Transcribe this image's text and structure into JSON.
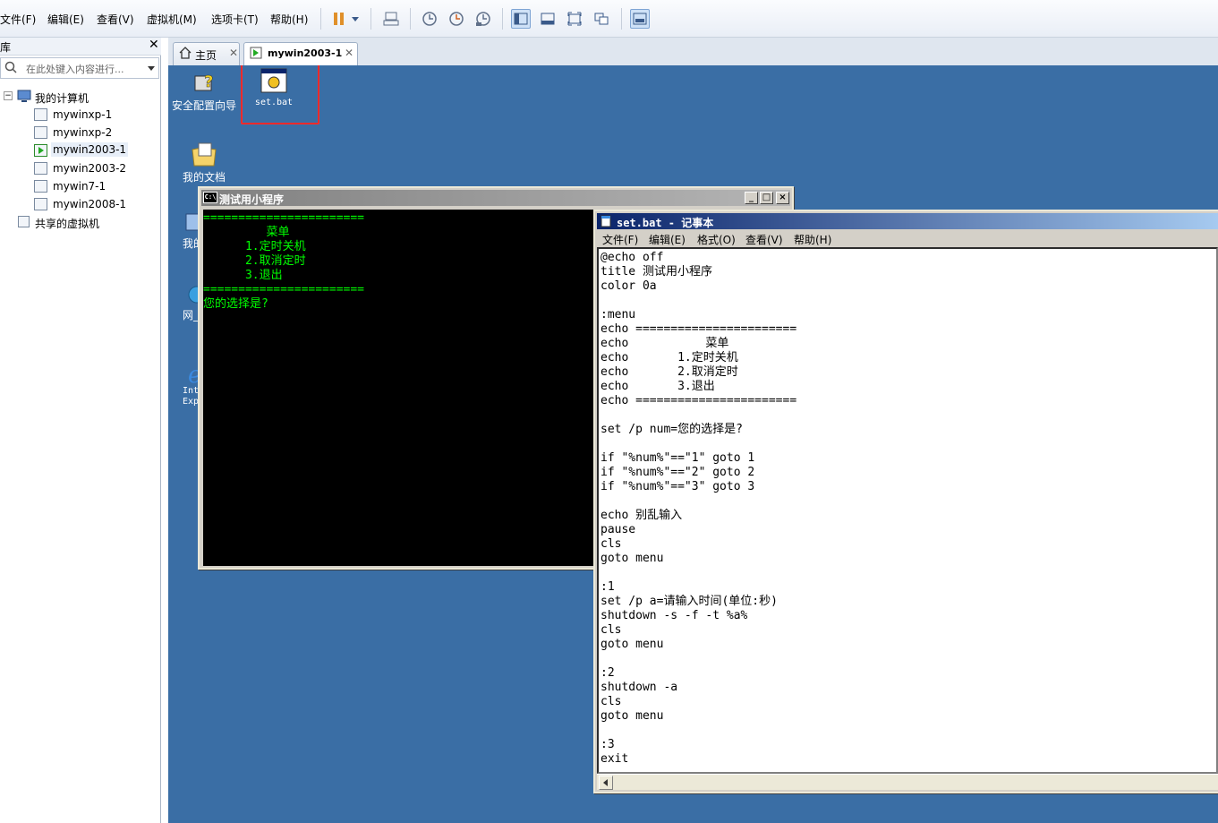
{
  "menubar": {
    "items": [
      "文件(F)",
      "编辑(E)",
      "查看(V)",
      "虚拟机(M)",
      "选项卡(T)",
      "帮助(H)"
    ]
  },
  "toolbar": {
    "icons": [
      "pause-icon",
      "dropdown-arrow-icon",
      "send-keys-icon",
      "snapshot-icon",
      "revert-snapshot-icon",
      "snapshot-manager-icon",
      "library-view-icon",
      "console-view-icon",
      "fullscreen-icon",
      "unity-icon",
      "thumbnail-icon"
    ],
    "accent_pause": "#e0902a"
  },
  "library": {
    "title": "库",
    "search_placeholder": "在此处键入内容进行...",
    "root": "我的计算机",
    "vms": [
      "mywinxp-1",
      "mywinxp-2",
      "mywin2003-1",
      "mywin2003-2",
      "mywin7-1",
      "mywin2008-1"
    ],
    "selected": "mywin2003-1",
    "shared": "共享的虚拟机"
  },
  "tabs": [
    {
      "label": "主页"
    },
    {
      "label": "mywin2003-1"
    }
  ],
  "desktop": {
    "background": "#3a6ea5",
    "icons": [
      {
        "label": "安全配置向导",
        "icon": "security-wizard-icon"
      },
      {
        "label": "set.bat",
        "icon": "batch-file-icon"
      },
      {
        "label": "我的文档",
        "icon": "my-documents-icon"
      },
      {
        "label": "我的",
        "icon": "my-computer-icon"
      },
      {
        "label": "网_",
        "icon": "network-icon"
      },
      {
        "label": "Int",
        "label2": "Exp",
        "icon": "internet-explorer-icon"
      }
    ],
    "highlight_color": "#ff2a2a"
  },
  "cmd": {
    "title": "测试用小程序",
    "lines": [
      "=======================",
      "         菜单",
      "      1.定时关机",
      "      2.取消定时",
      "      3.退出",
      "=======================",
      "您的选择是?"
    ]
  },
  "notepad": {
    "title": "set.bat - 记事本",
    "menu": [
      "文件(F)",
      "编辑(E)",
      "格式(O)",
      "查看(V)",
      "帮助(H)"
    ],
    "lines": [
      "@echo off",
      "title 测试用小程序",
      "color 0a",
      "",
      ":menu",
      "echo =======================",
      "echo           菜单",
      "echo       1.定时关机",
      "echo       2.取消定时",
      "echo       3.退出",
      "echo =======================",
      "",
      "set /p num=您的选择是?",
      "",
      "if \"%num%\"==\"1\" goto 1",
      "if \"%num%\"==\"2\" goto 2",
      "if \"%num%\"==\"3\" goto 3",
      "",
      "echo 别乱输入",
      "pause",
      "cls",
      "goto menu",
      "",
      ":1",
      "set /p a=请输入时间(单位:秒)",
      "shutdown -s -f -t %a%",
      "cls",
      "goto menu",
      "",
      ":2",
      "shutdown -a",
      "cls",
      "goto menu",
      "",
      ":3",
      "exit"
    ]
  }
}
